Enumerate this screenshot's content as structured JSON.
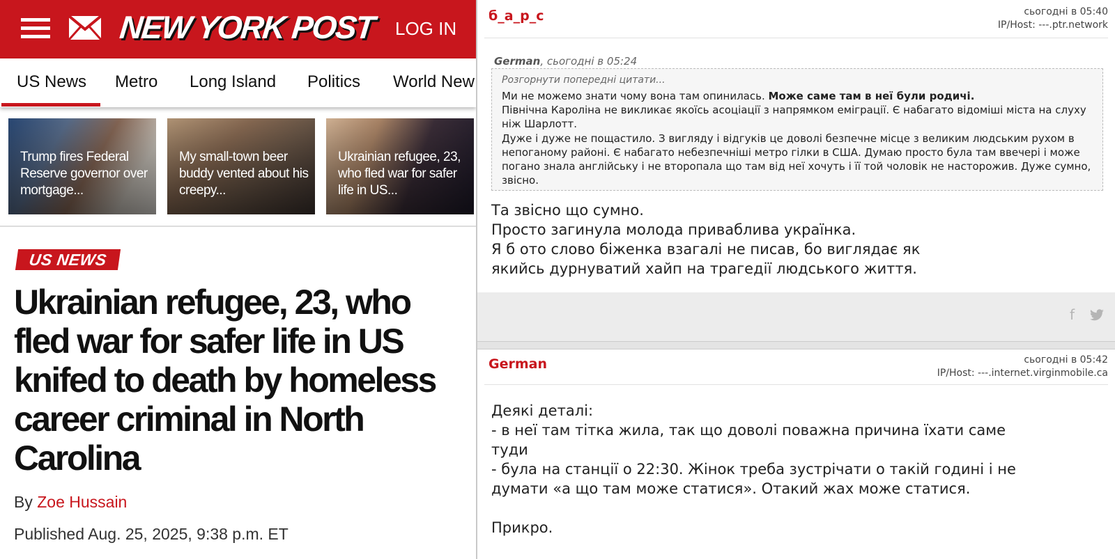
{
  "nypost": {
    "logo": "NEW YORK POST",
    "login": "LOG IN",
    "nav": [
      "US News",
      "Metro",
      "Long Island",
      "Politics",
      "World New"
    ],
    "thumbs": [
      {
        "caption": "Trump fires Federal Reserve governor over mortgage..."
      },
      {
        "caption": "My small-town beer buddy vented about his creepy..."
      },
      {
        "caption": "Ukrainian refugee, 23, who fled war for safer life in US..."
      }
    ],
    "section_tag": "US NEWS",
    "headline": "Ukrainian refugee, 23, who fled war for safer life in US knifed to death by homeless career criminal in North Carolina",
    "byline_prefix": "By",
    "author": "Zoe Hussain",
    "published": "Published Aug. 25, 2025, 9:38 p.m. ET",
    "brand_color": "#c8161d"
  },
  "forum": {
    "post1": {
      "author": "б_а_р_с",
      "time": "сьогодні в 05:40",
      "host": "IP/Host: ---.ptr.network",
      "quote_header_author": "German",
      "quote_header_time": ", сьогодні в 05:24",
      "quote_expand": "Розгорнути попередні цитати...",
      "quote_line1_normal": "Ми не можемо знати чому вона там опинилась. ",
      "quote_line1_bold": "Може саме там в неї були родичі.",
      "quote_rest": "Північна Кароліна не викликає якоїсь асоціації з напрямком еміграції. Є набагато відоміші міста на слуху ніж Шарлотт.\nДуже і дуже не пощастило. З вигляду і відгуків це доволі безпечне місце з великим людським рухом в непоганому районі. Є набагато небезпечніші метро гілки в США. Думаю просто була там ввечері і може погано знала англійську і не второпала що там від неї хочуть і її той чоловік не насторожив. Дуже сумно, звісно.",
      "body": "Та звісно що сумно.\nПросто загинула молода приваблива українка.\nЯ б ото слово біженка взагалі не писав, бо виглядає як\nякийсь дурнуватий хайп на трагедії людського життя."
    },
    "post2": {
      "author": "German",
      "time": "сьогодні в 05:42",
      "host": "IP/Host: ---.internet.virginmobile.ca",
      "body": "Деякі деталі:\n- в неї там тітка жила, так що доволі поважна причина їхати саме\nтуди\n- була на станції о 22:30. Жінок треба зустрічати о такій годині і не\nдумати «а що там може статися». Отакий жах може статися.\n\nПрикро."
    },
    "social_icons": [
      "facebook-icon",
      "twitter-icon"
    ]
  }
}
